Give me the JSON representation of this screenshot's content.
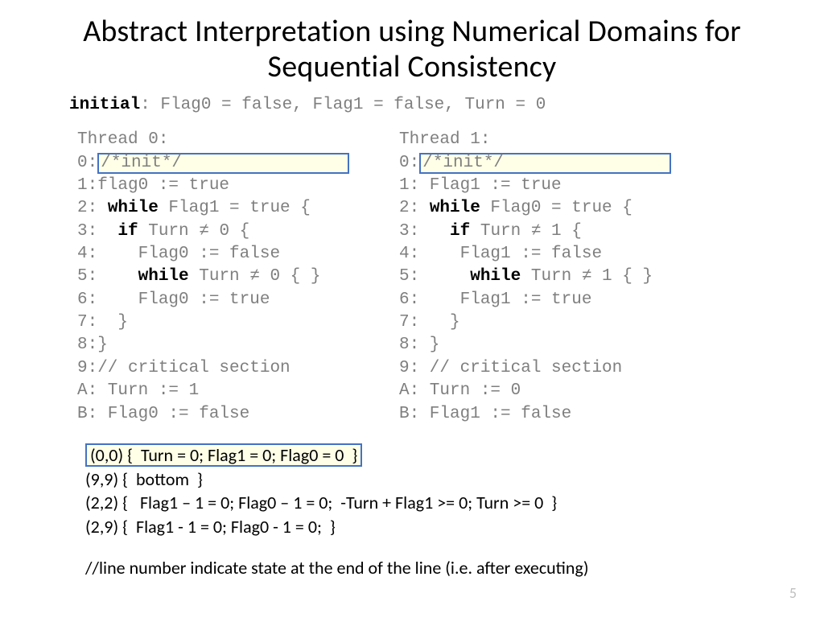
{
  "title": "Abstract Interpretation using  Numerical Domains for Sequential Consistency",
  "initial_label": "initial",
  "initial_text": ": Flag0 = false, Flag1 = false, Turn = 0",
  "thread0": {
    "header": "Thread 0:",
    "l0_prefix": "0:",
    "l0_hl": "/*init*/                ",
    "l1": "1:flag0 := true",
    "l2a": "2: ",
    "l2kw": "while",
    "l2b": " Flag1 = true {",
    "l3a": "3:  ",
    "l3kw": "if",
    "l3b": " Turn ≠ 0 {",
    "l4": "4:    Flag0 := false",
    "l5a": "5:    ",
    "l5kw": "while",
    "l5b": " Turn ≠ 0 { }",
    "l6": "6:    Flag0 := true",
    "l7": "7:  }",
    "l8": "8:}",
    "l9": "9:// critical section",
    "lA": "A: Turn := 1",
    "lB": "B: Flag0 := false"
  },
  "thread1": {
    "header": "Thread 1:",
    "l0_prefix": "0:",
    "l0_hl": "/*init*/                ",
    "l1": "1: Flag1 := true",
    "l2a": "2: ",
    "l2kw": "while",
    "l2b": " Flag0 = true {",
    "l3a": "3:   ",
    "l3kw": "if",
    "l3b": " Turn ≠ 1 {",
    "l4": "4:    Flag1 := false",
    "l5a": "5:     ",
    "l5kw": "while",
    "l5b": " Turn ≠ 1 { }",
    "l6": "6:    Flag1 := true",
    "l7": "7:   }",
    "l8": "8: }",
    "l9": "9: // critical section",
    "lA": "A: Turn := 0",
    "lB": "B: Flag1 := false"
  },
  "states": {
    "s0": "(0,0) {  Turn = 0; Flag1 = 0; Flag0 = 0  }",
    "s1": "(9,9) {  bottom  }",
    "s2": "(2,2) {   Flag1 – 1 = 0; Flag0 – 1 = 0;  -Turn + Flag1 >= 0; Turn >= 0  }",
    "s3": "(2,9) {  Flag1 - 1 = 0; Flag0 - 1 = 0;  }"
  },
  "note": "//line number indicate state at the end of the line (i.e. after executing)",
  "pagenum": "5"
}
